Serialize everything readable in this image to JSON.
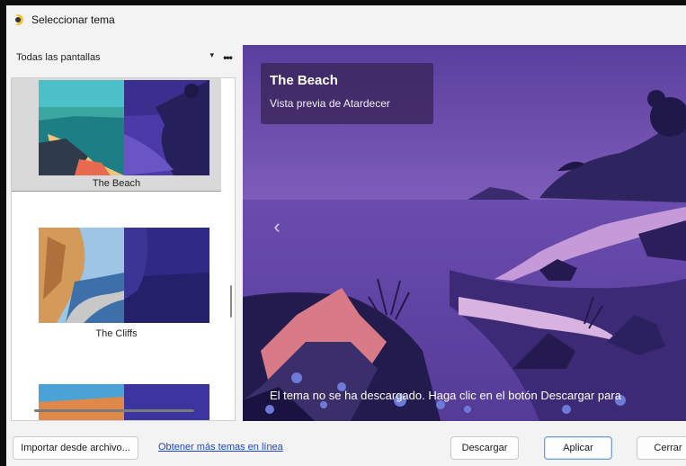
{
  "window": {
    "title": "Seleccionar tema",
    "icon": "theme-app-icon"
  },
  "toolbar": {
    "display_select": "Todas las pantallas",
    "more_label": "•••"
  },
  "themes": [
    {
      "name": "The Beach",
      "selected": true
    },
    {
      "name": "The Cliffs",
      "selected": false
    }
  ],
  "preview": {
    "title": "The Beach",
    "subtitle": "Vista previa de Atardecer",
    "prev_arrow": "‹",
    "notice": "El tema no se ha descargado. Haga clic en el botón Descargar para"
  },
  "footer": {
    "import_label": "Importar desde archivo...",
    "online_link": "Obtener más temas en línea",
    "download_label": "Descargar",
    "apply_label": "Aplicar",
    "close_label": "Cerrar"
  },
  "colors": {
    "selected_tile": "#d9d9d9",
    "link": "#1a47c4",
    "preview_sky": "#6b4aa6",
    "overlay": "#3a2458"
  }
}
